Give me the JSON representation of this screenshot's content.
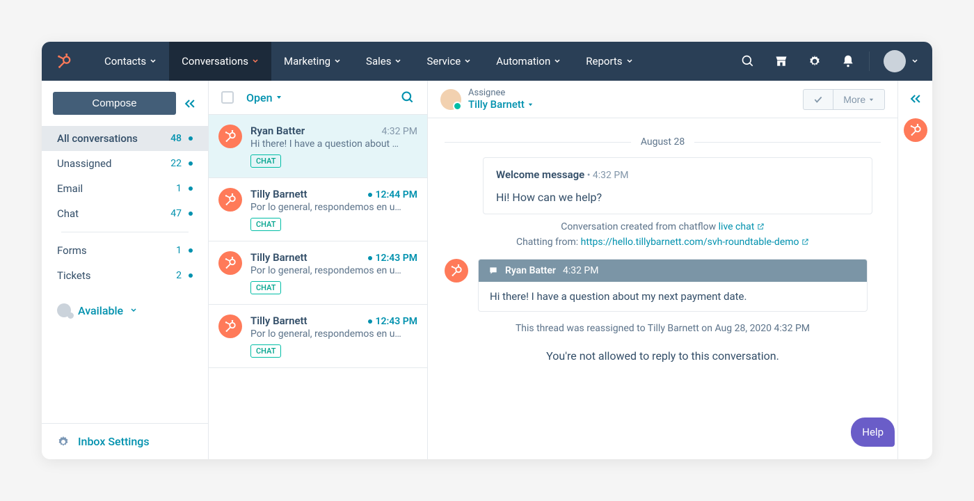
{
  "nav": {
    "items": [
      {
        "label": "Contacts"
      },
      {
        "label": "Conversations"
      },
      {
        "label": "Marketing"
      },
      {
        "label": "Sales"
      },
      {
        "label": "Service"
      },
      {
        "label": "Automation"
      },
      {
        "label": "Reports"
      }
    ]
  },
  "sidebar": {
    "compose": "Compose",
    "folders": [
      {
        "label": "All conversations",
        "count": "48",
        "selected": true
      },
      {
        "label": "Unassigned",
        "count": "22"
      },
      {
        "label": "Email",
        "count": "1"
      },
      {
        "label": "Chat",
        "count": "47"
      }
    ],
    "folders2": [
      {
        "label": "Forms",
        "count": "1"
      },
      {
        "label": "Tickets",
        "count": "2"
      }
    ],
    "status": "Available",
    "settings": "Inbox Settings"
  },
  "list": {
    "filter": "Open",
    "items": [
      {
        "name": "Ryan Batter",
        "time": "4:32 PM",
        "preview": "Hi there! I have a question about …",
        "badge": "CHAT",
        "selected": true,
        "unread": false
      },
      {
        "name": "Tilly Barnett",
        "time": "12:44 PM",
        "preview": "Por lo general, respondemos en u…",
        "badge": "CHAT",
        "unread": true
      },
      {
        "name": "Tilly Barnett",
        "time": "12:43 PM",
        "preview": "Por lo general, respondemos en u…",
        "badge": "CHAT",
        "unread": true
      },
      {
        "name": "Tilly Barnett",
        "time": "12:43 PM",
        "preview": "Por lo general, respondemos en u…",
        "badge": "CHAT",
        "unread": true
      }
    ]
  },
  "content": {
    "assignee_label": "Assignee",
    "assignee_name": "Tilly Barnett",
    "more": "More",
    "date": "August 28",
    "welcome": {
      "title": "Welcome message",
      "sep": " • ",
      "time": "4:32 PM",
      "text": "Hi! How can we help?"
    },
    "meta1_prefix": "Conversation created from chatflow ",
    "meta1_link": "live chat",
    "meta2_prefix": "Chatting from: ",
    "meta2_link": "https://hello.tillybarnett.com/svh-roundtable-demo",
    "msg": {
      "sender": "Ryan Batter",
      "time": "4:32 PM",
      "body": "Hi there! I have a question about my next payment date."
    },
    "reassign": "This thread was reassigned to Tilly Barnett on Aug 28, 2020 4:32 PM",
    "noreply": "You're not allowed to reply to this conversation.",
    "help": "Help"
  }
}
